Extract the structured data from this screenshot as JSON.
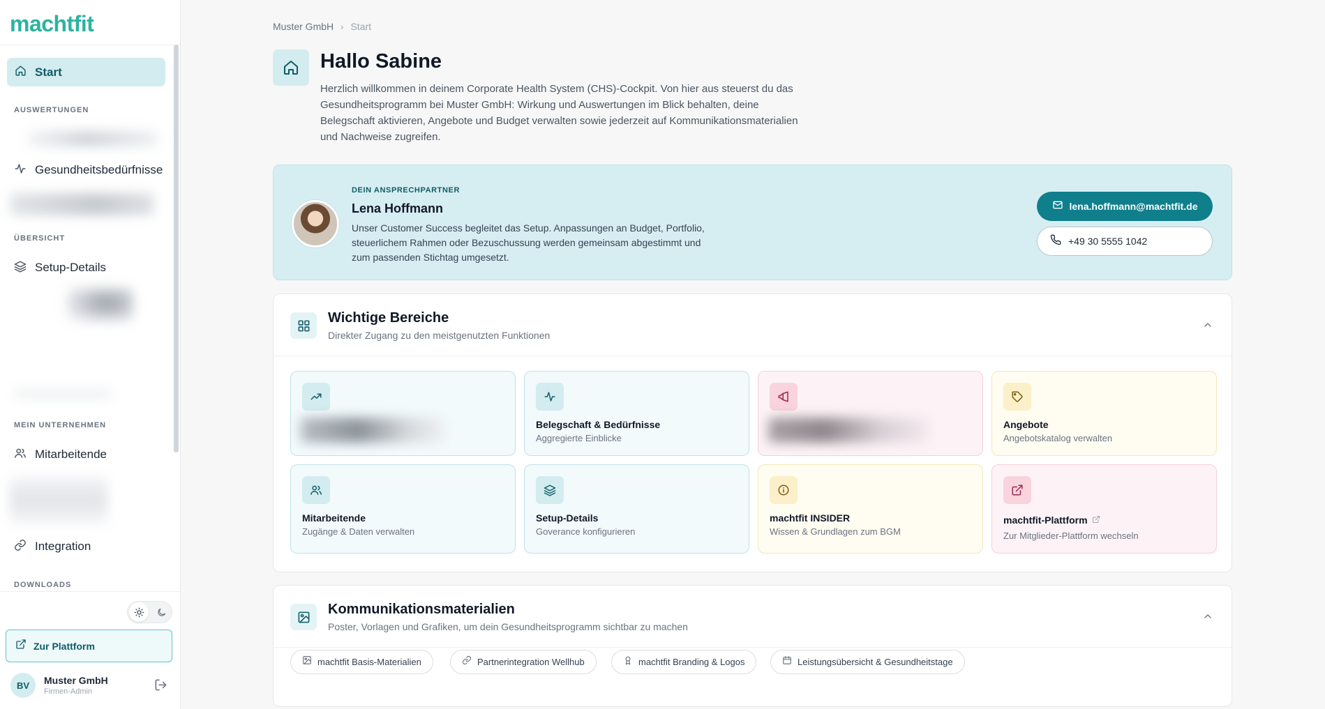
{
  "app": {
    "logo": "machtfit"
  },
  "sidebar": {
    "start_label": "Start",
    "sections": {
      "auswertungen": "AUSWERTUNGEN",
      "uebersicht": "ÜBERSICHT",
      "unternehmen": "MEIN UNTERNEHMEN",
      "downloads": "DOWNLOADS"
    },
    "items": {
      "gesundheit": "Gesundheitsbedürfnisse",
      "setup": "Setup-Details",
      "mitarbeitende": "Mitarbeitende",
      "integration": "Integration"
    },
    "platform_button": "Zur Plattform",
    "user": {
      "initials": "BV",
      "name": "Muster GmbH",
      "role": "Firmen-Admin"
    }
  },
  "breadcrumb": {
    "company": "Muster GmbH",
    "separator": "›",
    "current": "Start"
  },
  "header": {
    "title": "Hallo Sabine",
    "intro": "Herzlich willkommen in deinem Corporate Health System (CHS)-Cockpit. Von hier aus steuerst du das Gesundheitsprogramm bei Muster GmbH: Wirkung und Auswertungen im Blick behalten, deine Belegschaft aktivieren, Angebote und Budget verwalten sowie jederzeit auf Kommunikationsmaterialien und Nachweise zugreifen."
  },
  "contact": {
    "kicker": "DEIN ANSPRECHPARTNER",
    "name": "Lena Hoffmann",
    "description": "Unser Customer Success begleitet das Setup. Anpassungen an Budget, Portfolio, steuerlichem Rahmen oder Bezuschussung werden gemeinsam abgestimmt und zum passenden Stichtag umgesetzt.",
    "email": "lena.hoffmann@machtfit.de",
    "phone": "+49 30 5555 1042"
  },
  "areas": {
    "title": "Wichtige Bereiche",
    "subtitle": "Direkter Zugang zu den meistgenutzten Funktionen",
    "tiles": [
      {
        "title": "Belegschaft & Bedürfnisse",
        "subtitle": "Aggregierte Einblicke"
      },
      {
        "title": "Angebote",
        "subtitle": "Angebotskatalog verwalten"
      },
      {
        "title": "Mitarbeitende",
        "subtitle": "Zugänge & Daten verwalten"
      },
      {
        "title": "Setup-Details",
        "subtitle": "Goverance konfigurieren"
      },
      {
        "title": "machtfit INSIDER",
        "subtitle": "Wissen & Grundlagen zum BGM"
      },
      {
        "title": "machtfit-Plattform",
        "subtitle": "Zur Mitglieder-Plattform wechseln"
      }
    ]
  },
  "materials": {
    "title": "Kommunikationsmaterialien",
    "subtitle": "Poster, Vorlagen und Grafiken, um dein Gesundheitsprogramm sichtbar zu machen",
    "chips": [
      "machtfit Basis-Materialien",
      "Partnerintegration Wellhub",
      "machtfit Branding & Logos",
      "Leistungsübersicht & Gesundheitstage"
    ]
  },
  "colors": {
    "accent": "#0f7f8c",
    "brand": "#2bb3a0",
    "active_bg": "#d3ecef"
  }
}
